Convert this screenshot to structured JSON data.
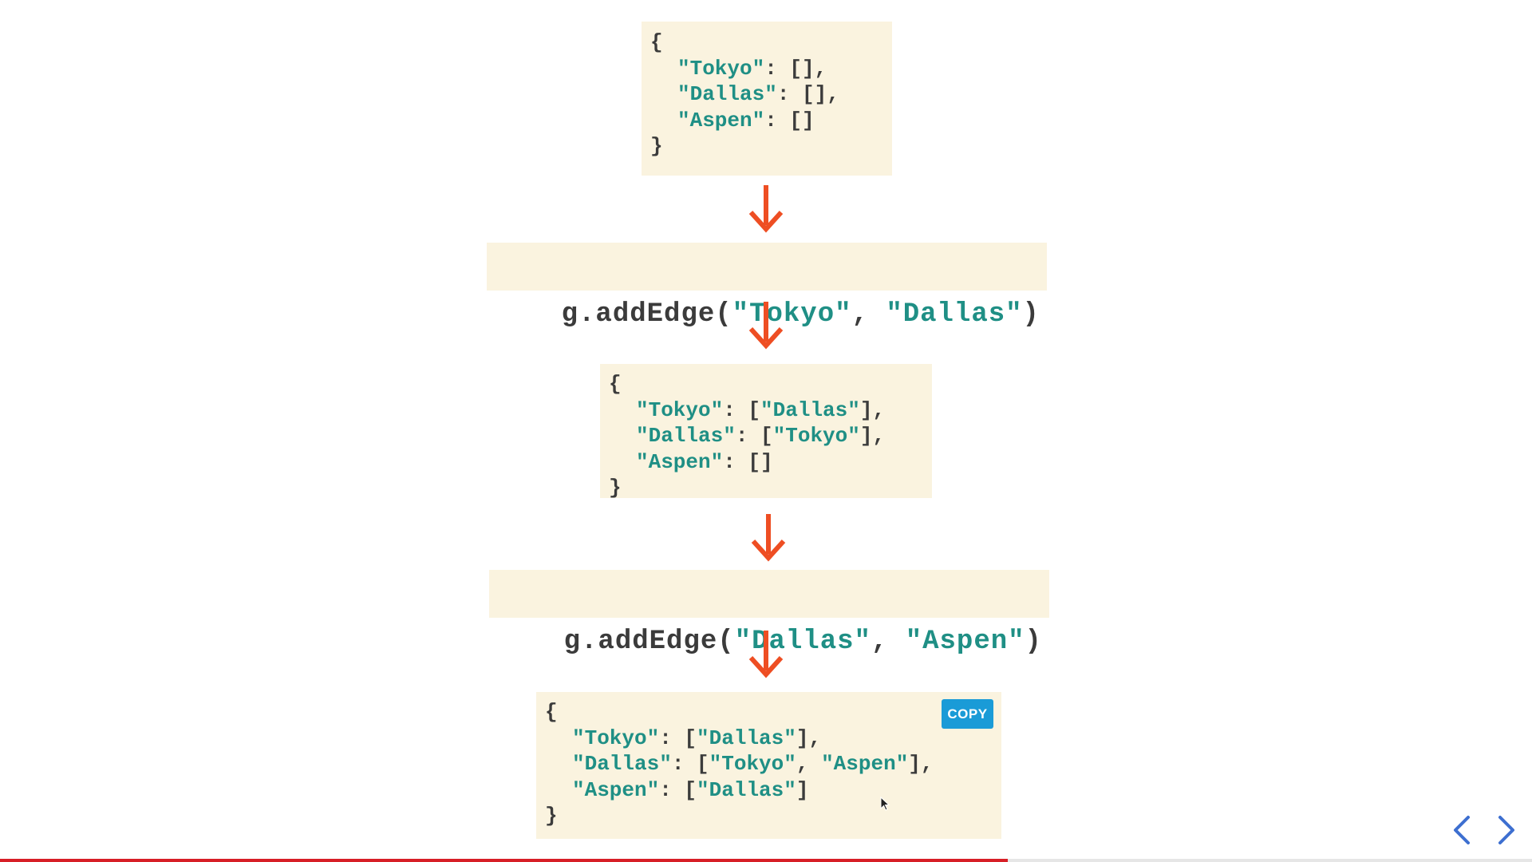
{
  "blocks": {
    "initial": [
      "{",
      [
        "\"Tokyo\"",
        ": [],"
      ],
      [
        "\"Dallas\"",
        ": [],"
      ],
      [
        "\"Aspen\"",
        ": []"
      ],
      "}"
    ],
    "after_first": [
      "{",
      [
        "\"Tokyo\"",
        ": [",
        "\"Dallas\"",
        "],"
      ],
      [
        "\"Dallas\"",
        ": [",
        "\"Tokyo\"",
        "],"
      ],
      [
        "\"Aspen\"",
        ": []"
      ],
      "}"
    ],
    "after_second": [
      "{",
      [
        "\"Tokyo\"",
        ": [",
        "\"Dallas\"",
        "],"
      ],
      [
        "\"Dallas\"",
        ": [",
        "\"Tokyo\"",
        ", ",
        "\"Aspen\"",
        "],"
      ],
      [
        "\"Aspen\"",
        ": [",
        "\"Dallas\"",
        "]"
      ],
      "}"
    ]
  },
  "calls": {
    "first": {
      "prefix": "g.addEdge(",
      "arg1": "\"Tokyo\"",
      "sep": ", ",
      "arg2": "\"Dallas\"",
      "suffix": ")"
    },
    "second": {
      "prefix": "g.addEdge(",
      "arg1": "\"Dallas\"",
      "sep": ", ",
      "arg2": "\"Aspen\"",
      "suffix": ")"
    }
  },
  "copy_button_label": "COPY",
  "navigation": {
    "prev_icon": "chevron-left-icon",
    "next_icon": "chevron-right-icon"
  },
  "progress": {
    "fraction": 0.658
  },
  "colors": {
    "code_background": "#faf3df",
    "string": "#1f8f85",
    "text": "#3b3b3b",
    "arrow": "#ee4e23",
    "copy_button": "#1a9bd7",
    "progress": "#d71f26",
    "nav": "#3d6fd0"
  }
}
